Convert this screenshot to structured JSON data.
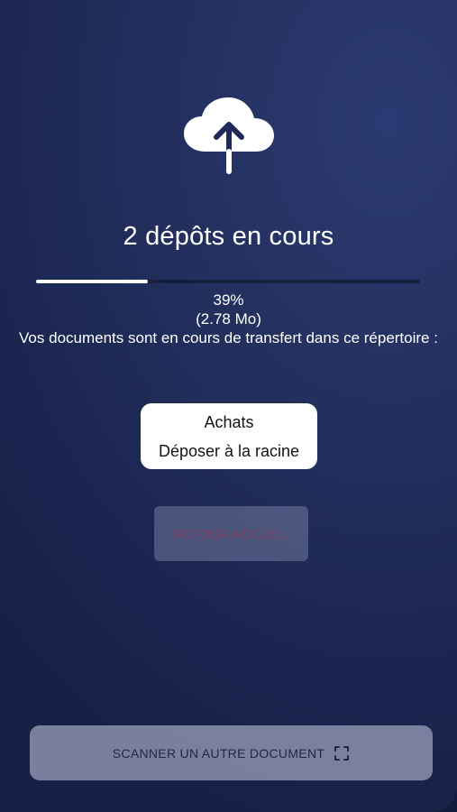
{
  "upload": {
    "icon": "cloud-upload-icon",
    "title": "2 dépôts en cours",
    "progress_percent": 39,
    "progress_label": "39%",
    "size_label": "(2.78 Mo)",
    "message": "Vos documents sont en cours de transfert dans ce répertoire :"
  },
  "destination": {
    "folder": "Achats",
    "action": "Déposer à la racine"
  },
  "buttons": {
    "home": "RETOUR ACCUEIL",
    "scan": "SCANNER UN AUTRE DOCUMENT",
    "scan_icon": "scan-frame-icon"
  },
  "colors": {
    "background": "#1f2a58",
    "progress_fill": "#ffffff",
    "progress_track": "#182040",
    "home_button_text": "#8a3b63"
  }
}
